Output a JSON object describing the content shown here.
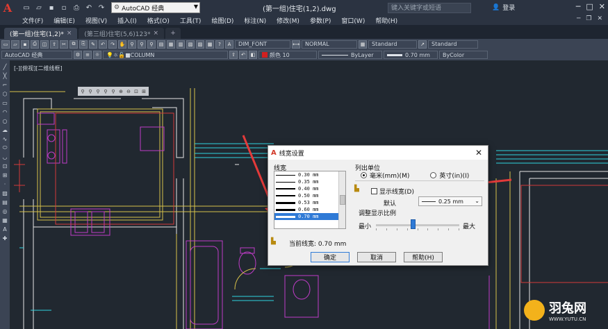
{
  "titlebar": {
    "workspace": "AutoCAD 经典",
    "doc_title": "(第一组)住宅(1,2).dwg",
    "search_placeholder": "键入关键字或短语",
    "login": "登录"
  },
  "menu": [
    "文件(F)",
    "编辑(E)",
    "视图(V)",
    "插入(I)",
    "格式(O)",
    "工具(T)",
    "绘图(D)",
    "标注(N)",
    "修改(M)",
    "参数(P)",
    "窗口(W)",
    "帮助(H)"
  ],
  "tabs": [
    {
      "label": "(第一组)住宅(1,2)*",
      "active": true
    },
    {
      "label": "(第三组)住宅(5,6)123*",
      "active": false
    }
  ],
  "toolbar1": {
    "text_style": "DIM_FONT",
    "dim_style": "NORMAL",
    "table_style": "Standard",
    "multileader_style": "Standard"
  },
  "toolbar2": {
    "workspace": "AutoCAD 经典",
    "layer": "COLUMN",
    "color": "颜色 10",
    "linetype": "ByLayer",
    "lineweight": "0.70 mm",
    "plot_style": "ByColor"
  },
  "canvas": {
    "viewport_label": "[-][俯视][二维线框]"
  },
  "dialog": {
    "title": "线宽设置",
    "list_label": "线宽",
    "items": [
      {
        "label": "0.30 mm",
        "thickness": 1
      },
      {
        "label": "0.35 mm",
        "thickness": 1
      },
      {
        "label": "0.40 mm",
        "thickness": 2
      },
      {
        "label": "0.50 mm",
        "thickness": 2
      },
      {
        "label": "0.53 mm",
        "thickness": 3
      },
      {
        "label": "0.60 mm",
        "thickness": 3
      },
      {
        "label": "0.70 mm",
        "thickness": 3,
        "selected": true
      }
    ],
    "current_label": "当前线宽:",
    "current_value": "0.70 mm",
    "units_label": "列出单位",
    "unit_mm": "毫米(mm)(M)",
    "unit_in": "英寸(in)(I)",
    "show_lw": "显示线宽(D)",
    "default_label": "默认",
    "default_value": "0.25 mm",
    "scale_label": "调整显示比例",
    "min_label": "最小",
    "max_label": "最大",
    "ok": "确定",
    "cancel": "取消",
    "help": "帮助(H)"
  },
  "watermark": {
    "name": "羽兔网",
    "url": "WWW.YUTU.CN"
  },
  "colors": {
    "wall_white": "#e6e6e6",
    "yellow": "#d8c24a",
    "magenta": "#c03cc8",
    "cyan": "#2fd4e0",
    "red": "#d43a3a",
    "arrow_red": "#e33a3a"
  }
}
